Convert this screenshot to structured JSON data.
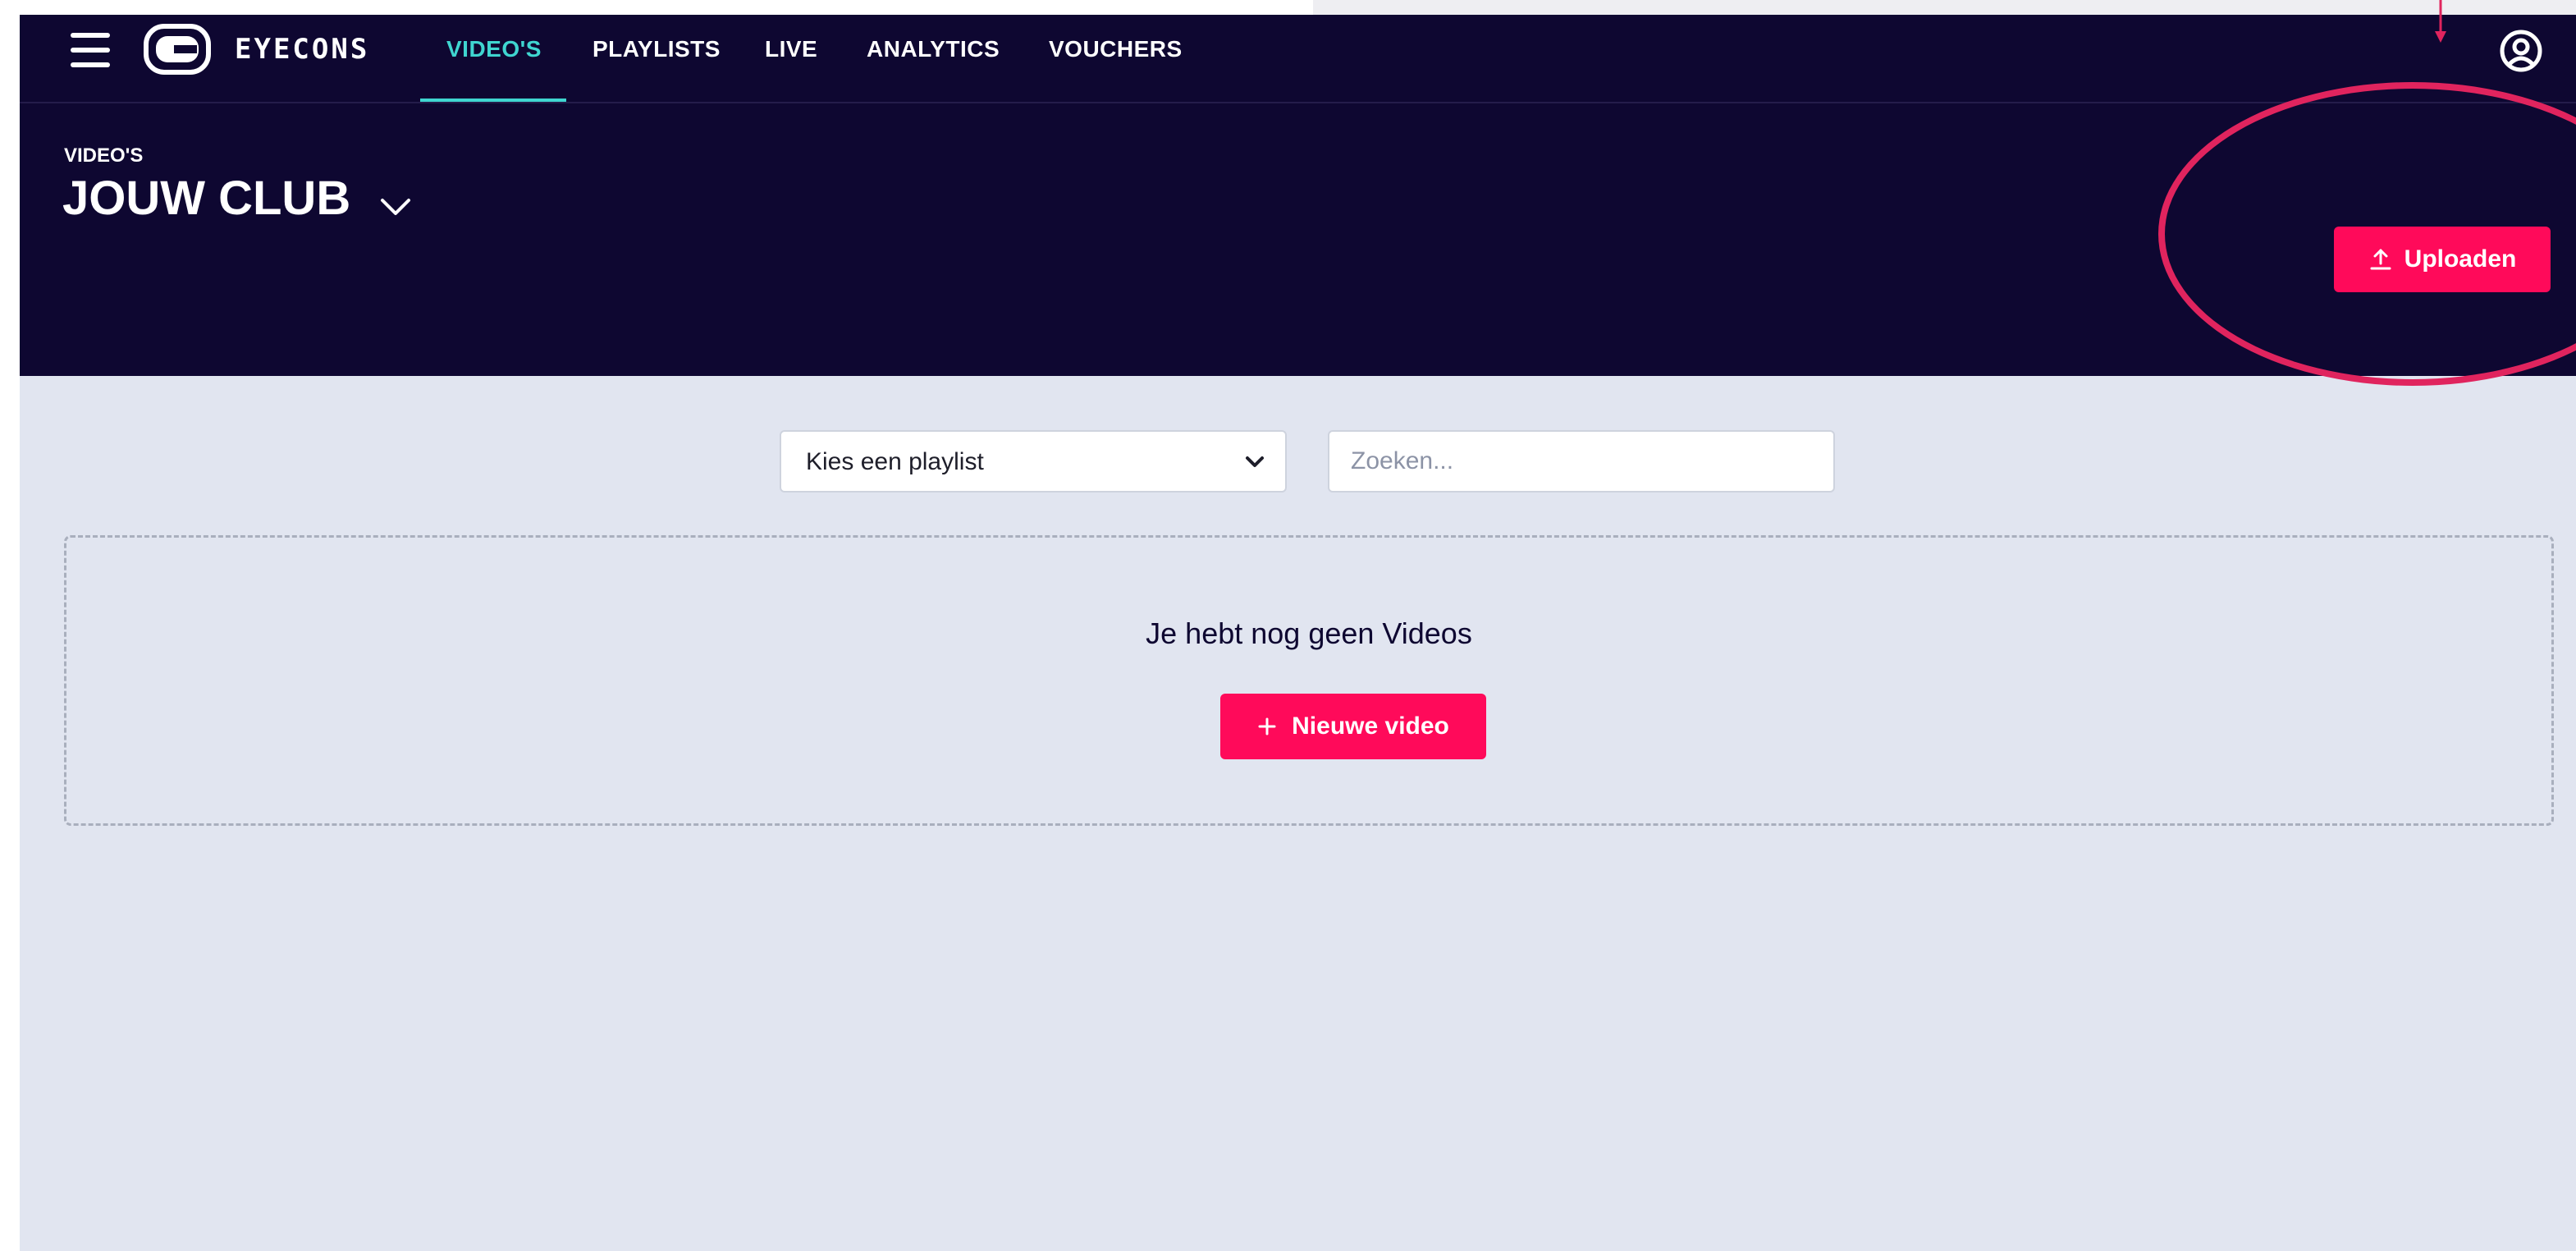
{
  "app": {
    "brand": "EYECONS"
  },
  "nav": {
    "items": [
      {
        "label": "VIDEO'S",
        "active": true
      },
      {
        "label": "PLAYLISTS",
        "active": false
      },
      {
        "label": "LIVE",
        "active": false
      },
      {
        "label": "ANALYTICS",
        "active": false
      },
      {
        "label": "VOUCHERS",
        "active": false
      }
    ],
    "menu_icon": "hamburger-icon",
    "account_icon": "user-circle-icon"
  },
  "header": {
    "breadcrumb": "VIDEO'S",
    "club_title": "JOUW CLUB",
    "club_chevron_icon": "chevron-down-icon",
    "upload_label": "Uploaden",
    "upload_icon": "upload-icon"
  },
  "filters": {
    "playlist_value": "Kies een playlist",
    "search_placeholder": "Zoeken...",
    "search_value": ""
  },
  "empty_state": {
    "message": "Je hebt nog geen Videos",
    "new_video_label": "Nieuwe video",
    "new_video_icon": "plus-icon"
  },
  "colors": {
    "navy": "#0e0731",
    "accent_teal": "#3fd5d0",
    "brand_pink": "#ff0a5a",
    "annotation_red": "#e0245e",
    "background": "#e1e5f0"
  }
}
